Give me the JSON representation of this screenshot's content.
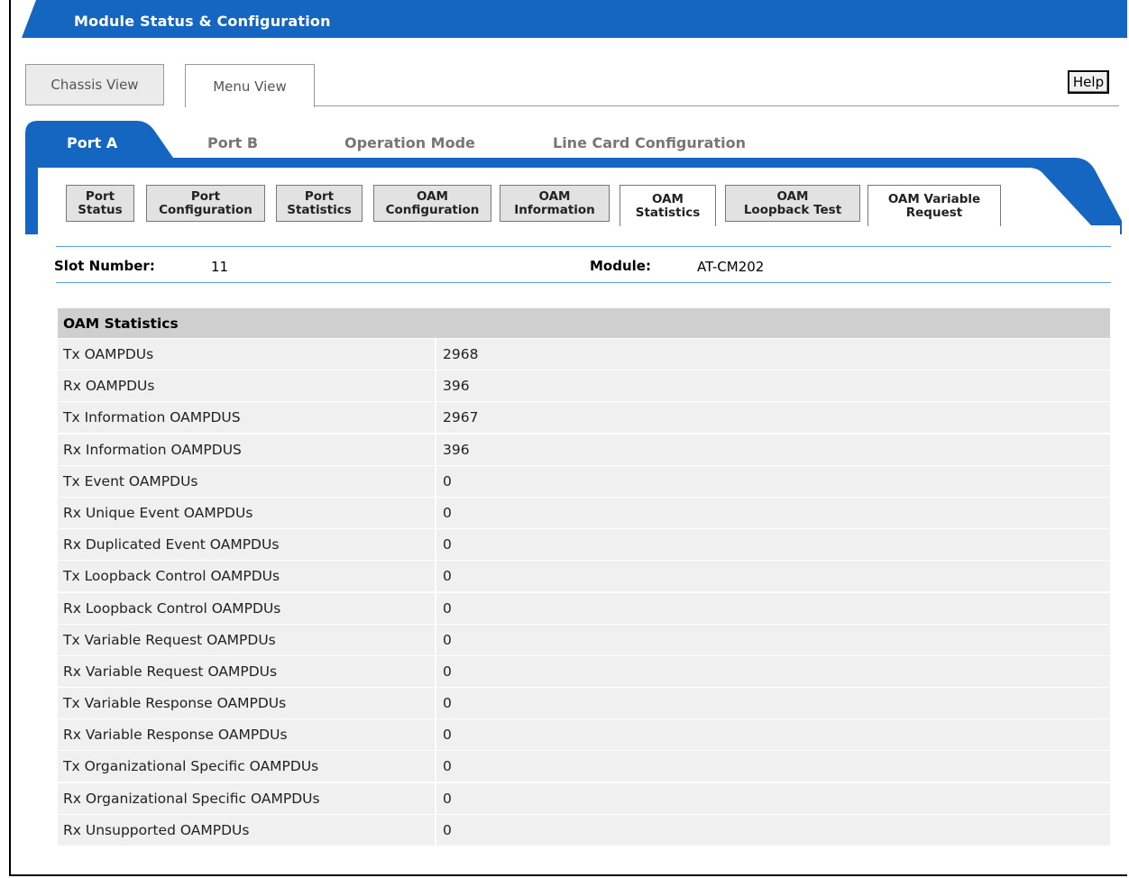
{
  "title": "Module Status & Configuration",
  "view_tabs": [
    {
      "label": "Chassis View"
    },
    {
      "label": "Menu View"
    }
  ],
  "help_label": "Help",
  "port_tabs": [
    {
      "label": "Port A"
    },
    {
      "label": "Port B"
    },
    {
      "label": "Operation Mode"
    },
    {
      "label": "Line Card Configuration"
    }
  ],
  "sub_tabs": [
    {
      "line1": "Port",
      "line2": "Status"
    },
    {
      "line1": "Port",
      "line2": "Configuration"
    },
    {
      "line1": "Port",
      "line2": "Statistics"
    },
    {
      "line1": "OAM",
      "line2": "Configuration"
    },
    {
      "line1": "OAM",
      "line2": "Information"
    },
    {
      "line1": "OAM",
      "line2": "Statistics"
    },
    {
      "line1": "OAM",
      "line2": "Loopback Test"
    },
    {
      "line1": "OAM Variable",
      "line2": "Request"
    }
  ],
  "slot": {
    "label": "Slot Number:",
    "value": "11"
  },
  "module": {
    "label": "Module:",
    "value": "AT-CM202"
  },
  "stats": {
    "header": "OAM Statistics",
    "rows": [
      {
        "name": "Tx OAMPDUs",
        "value": "2968"
      },
      {
        "name": "Rx OAMPDUs",
        "value": "396"
      },
      {
        "name": "Tx Information OAMPDUS",
        "value": "2967"
      },
      {
        "name": "Rx Information OAMPDUS",
        "value": "396"
      },
      {
        "name": "Tx Event OAMPDUs",
        "value": "0"
      },
      {
        "name": "Rx Unique Event OAMPDUs",
        "value": "0"
      },
      {
        "name": "Rx Duplicated Event OAMPDUs",
        "value": "0"
      },
      {
        "name": "Tx Loopback Control OAMPDUs",
        "value": "0"
      },
      {
        "name": "Rx Loopback Control OAMPDUs",
        "value": "0"
      },
      {
        "name": "Tx Variable Request OAMPDUs",
        "value": "0"
      },
      {
        "name": "Rx Variable Request OAMPDUs",
        "value": "0"
      },
      {
        "name": "Tx Variable Response OAMPDUs",
        "value": "0"
      },
      {
        "name": "Rx Variable Response OAMPDUs",
        "value": "0"
      },
      {
        "name": "Tx Organizational Specific OAMPDUs",
        "value": "0"
      },
      {
        "name": "Rx Organizational Specific OAMPDUs",
        "value": "0"
      },
      {
        "name": "Rx Unsupported OAMPDUs",
        "value": "0"
      }
    ]
  },
  "colors": {
    "brand_blue": "#1466c0",
    "panel_gray": "#f0f0f0",
    "header_gray": "#cfcfcf",
    "separator_blue": "#5a9fd4"
  }
}
